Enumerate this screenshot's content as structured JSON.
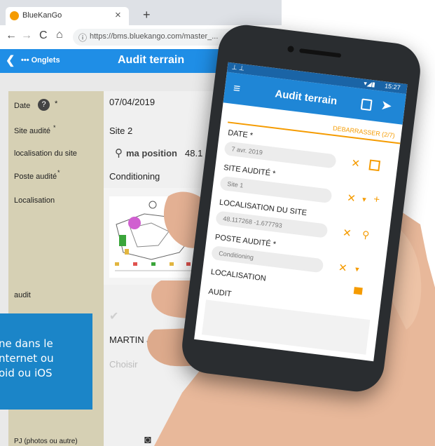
{
  "browser": {
    "tab_title": "BlueKanGo",
    "tab_close": "×",
    "new_tab": "+",
    "url": "https://bms.bluekango.com/master_..."
  },
  "app_bar": {
    "back_label": "••• Onglets",
    "title": "Audit terrain"
  },
  "form": {
    "rows": [
      {
        "label": "Date",
        "required": "*",
        "value": "07/04/2019"
      },
      {
        "label": "Site audité",
        "required": "*",
        "value": "Site 2"
      },
      {
        "label": "localisation du site",
        "position_label": "ma position",
        "position_value": "48.1"
      },
      {
        "label": "Poste audité",
        "required": "*",
        "value": "Conditioning"
      },
      {
        "label": "Localisation"
      },
      {
        "label": "audit"
      },
      {
        "label": "",
        "value": "MARTIN Jean-l"
      },
      {
        "label": "",
        "placeholder": "Choisir"
      },
      {
        "label": "PJ (photos ou autre)"
      }
    ]
  },
  "promo": {
    "line1": "ne dans le",
    "line2": "nternet ou",
    "line3": "oid ou iOS"
  },
  "phone": {
    "time": "15:27",
    "title": "Audit terrain",
    "section": "DEBARRASSER (2/7)",
    "fields": [
      {
        "label": "DATE *",
        "value": "7 avr. 2019"
      },
      {
        "label": "SITE AUDITÉ *",
        "value": "Site 1"
      },
      {
        "label": "LOCALISATION DU SITE",
        "value": "48.117268 -1.677793"
      },
      {
        "label": "POSTE AUDITÉ *",
        "value": "Conditioning"
      },
      {
        "label": "LOCALISATION"
      },
      {
        "label": "AUDIT"
      }
    ]
  },
  "colors": {
    "brand_blue": "#1f8ee6",
    "accent_orange": "#f59b00"
  }
}
